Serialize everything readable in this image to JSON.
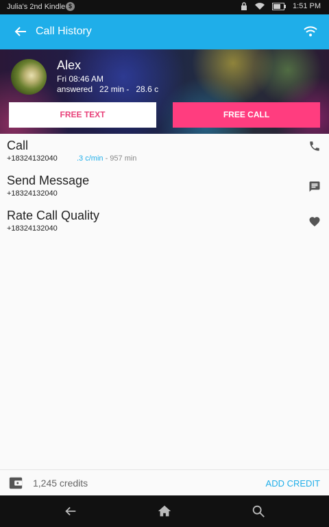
{
  "status_bar": {
    "device_name": "Julia's 2nd Kindle",
    "badge": "$",
    "time": "1:51 PM",
    "icons": [
      "lock-icon",
      "wifi-icon",
      "battery-icon"
    ]
  },
  "app_bar": {
    "title": "Call History",
    "back_icon": "arrow-left-icon",
    "action_icon": "wifi-icon",
    "color": "#1faee9"
  },
  "contact": {
    "name": "Alex",
    "datetime": "Fri 08:46 AM",
    "details": "answered   22 min -   28.6 c",
    "free_text_label": "FREE TEXT",
    "free_call_label": "FREE CALL",
    "accent": "#ff3d7f"
  },
  "actions": [
    {
      "label": "Call",
      "number": "+18324132040",
      "rate": ".3 c/min",
      "minutes": " - 957 min",
      "icon": "phone-icon"
    },
    {
      "label": "Send Message",
      "number": "+18324132040",
      "icon": "message-icon"
    },
    {
      "label": "Rate Call Quality",
      "number": "+18324132040",
      "icon": "heart-icon"
    }
  ],
  "footer": {
    "credits": "1,245 credits",
    "add_credit_label": "ADD CREDIT",
    "wallet_icon": "wallet-icon"
  },
  "nav": {
    "icons": [
      "back-arrow-icon",
      "home-icon",
      "search-icon"
    ]
  }
}
